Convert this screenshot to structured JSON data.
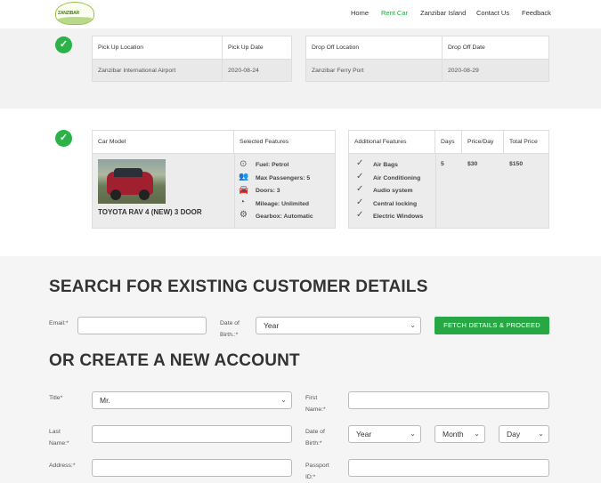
{
  "nav": {
    "logo_text": "ZANZIBAR",
    "logo_sub": "CAR RENTAL",
    "items": [
      {
        "label": "Home",
        "active": false
      },
      {
        "label": "Rent Car",
        "active": true
      },
      {
        "label": "Zanzibar Island",
        "active": false
      },
      {
        "label": "Contact Us",
        "active": false
      },
      {
        "label": "Feedback",
        "active": false
      }
    ]
  },
  "locations": {
    "pickup_location_header": "Pick Up Location",
    "pickup_date_header": "Pick Up Date",
    "pickup_location": "Zanzibar International Airport",
    "pickup_date": "2020-08-24",
    "dropoff_location_header": "Drop Off Location",
    "dropoff_date_header": "Drop Off Date",
    "dropoff_location": "Zanzibar Ferry Port",
    "dropoff_date": "2020-08-29"
  },
  "car": {
    "model_header": "Car Model",
    "features_header": "Selected Features",
    "model_name": "TOYOTA RAV 4 (NEW) 3 DOOR",
    "features": [
      {
        "icon": "fuel-icon",
        "glyph": "⊙",
        "text": "Fuel: Petrol"
      },
      {
        "icon": "passengers-icon",
        "glyph": "👥",
        "text": "Max Passengers: 5"
      },
      {
        "icon": "car-door-icon",
        "glyph": "🚘",
        "text": "Doors: 3"
      },
      {
        "icon": "speedometer-icon",
        "glyph": "◔",
        "text": "Mileage: Unlimited"
      },
      {
        "icon": "gear-icon",
        "glyph": "⚙",
        "text": "Gearbox: Automatic"
      }
    ]
  },
  "pricing": {
    "additional_header": "Additional Features",
    "days_header": "Days",
    "price_day_header": "Price/Day",
    "total_header": "Total Price",
    "additional": [
      "Air Bags",
      "Air Conditioning",
      "Audio system",
      "Central locking",
      "Electric Windows"
    ],
    "days": "5",
    "price_day": "$30",
    "total": "$150"
  },
  "search": {
    "title": "SEARCH FOR EXISTING CUSTOMER DETAILS",
    "email_label": "Email:*",
    "email_value": "",
    "dob_label_1": "Date of",
    "dob_label_2": "Birth.:*",
    "dob_year": "Year",
    "button": "FETCH DETAILS & PROCEED"
  },
  "create": {
    "title": "OR CREATE A NEW ACCOUNT",
    "title_label": "Title*",
    "title_value": "Mr.",
    "first_name_label_1": "First",
    "first_name_label_2": "Name:*",
    "first_name_value": "",
    "last_name_label_1": "Last",
    "last_name_label_2": "Name:*",
    "last_name_value": "",
    "dob_label_1": "Date of",
    "dob_label_2": "Birth:*",
    "dob_year": "Year",
    "dob_month": "Month",
    "dob_day": "Day",
    "address_label": "Address:*",
    "address_value": "",
    "passport_label_1": "Passport",
    "passport_label_2": "ID:*",
    "passport_value": ""
  },
  "colors": {
    "accent": "#28a745",
    "check": "#2bb34a"
  }
}
